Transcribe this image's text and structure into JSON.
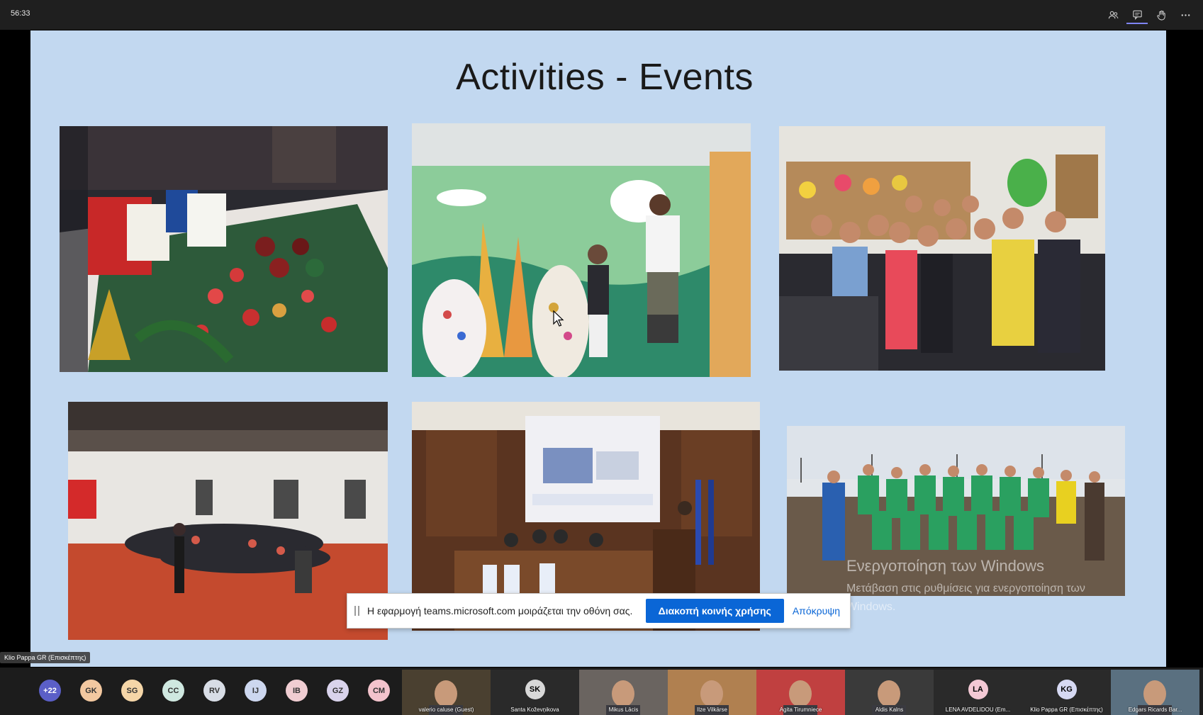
{
  "meeting": {
    "elapsed_time": "56:33",
    "toolbar_icons": [
      "people-icon",
      "chat-icon",
      "raise-hand-icon",
      "more-options-icon"
    ]
  },
  "slide": {
    "title": "Activities - Events"
  },
  "windows_watermark": {
    "title": "Ενεργοποίηση των Windows",
    "subtitle": "Μετάβαση στις ρυθμίσεις για ενεργοποίηση των Windows."
  },
  "sharing_bar": {
    "message": "Η εφαρμογή teams.microsoft.com μοιράζεται την οθόνη σας.",
    "stop_label": "Διακοπή κοινής χρήσης",
    "hide_label": "Απόκρυψη"
  },
  "presenter": {
    "name": "Klio Pappa GR (Επισκέπτης)"
  },
  "participants": {
    "overflow_count": "+22",
    "avatars": [
      {
        "initials": "GK",
        "color": "#f3c8a0"
      },
      {
        "initials": "SG",
        "color": "#f5d6a8"
      },
      {
        "initials": "CC",
        "color": "#cfe8e0"
      },
      {
        "initials": "RV",
        "color": "#d8dde6"
      },
      {
        "initials": "IJ",
        "color": "#cdd7ef"
      },
      {
        "initials": "IB",
        "color": "#f0cdd2"
      },
      {
        "initials": "GZ",
        "color": "#d9d3ec"
      },
      {
        "initials": "CM",
        "color": "#f3c3cc"
      }
    ],
    "tiles": [
      {
        "name": "valerio caluse (Guest)",
        "type": "video"
      },
      {
        "name": "Santa Koževņikova",
        "type": "avatar",
        "initials": "SK",
        "color": "#d8d8d8"
      },
      {
        "name": "Mikus Lācis",
        "type": "video"
      },
      {
        "name": "Ilze Vilkārse",
        "type": "video"
      },
      {
        "name": "Agita Tirumniece",
        "type": "video"
      },
      {
        "name": "Aldis Kalns",
        "type": "video"
      },
      {
        "name": "LENA AVDELIDOU (Em...",
        "type": "avatar",
        "initials": "LA",
        "color": "#f3c8d4"
      },
      {
        "name": "Klio Pappa GR (Επισκέπτης)",
        "type": "avatar",
        "initials": "KG",
        "color": "#d6d9f3"
      },
      {
        "name": "Edgars Ricards Bar...",
        "type": "video"
      }
    ]
  }
}
